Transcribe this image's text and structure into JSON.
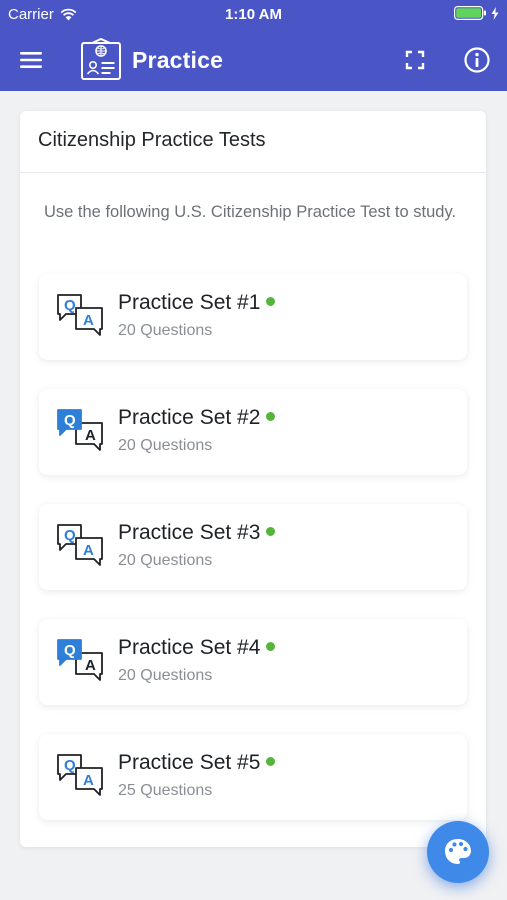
{
  "status_bar": {
    "carrier": "Carrier",
    "time": "1:10 AM"
  },
  "toolbar": {
    "title": "Practice",
    "menu_icon": "hamburger-menu-icon",
    "logo_icon": "citizenship-id-card-icon",
    "expand_icon": "fullscreen-expand-icon",
    "info_icon": "info-icon"
  },
  "card": {
    "title": "Citizenship Practice Tests",
    "description": "Use the following U.S. Citizenship Practice Test to study.",
    "sets": [
      {
        "title": "Practice Set #1",
        "subtitle": "20 Questions",
        "icon": "qa-outline-icon",
        "status_color": "#55b43a"
      },
      {
        "title": "Practice Set #2",
        "subtitle": "20 Questions",
        "icon": "qa-filled-icon",
        "status_color": "#55b43a"
      },
      {
        "title": "Practice Set #3",
        "subtitle": "20 Questions",
        "icon": "qa-outline-icon",
        "status_color": "#55b43a"
      },
      {
        "title": "Practice Set #4",
        "subtitle": "20 Questions",
        "icon": "qa-filled-icon",
        "status_color": "#55b43a"
      },
      {
        "title": "Practice Set #5",
        "subtitle": "25 Questions",
        "icon": "qa-outline-icon",
        "status_color": "#55b43a"
      }
    ]
  },
  "fab": {
    "icon": "palette-icon"
  },
  "colors": {
    "header": "#4a56c6",
    "accent_blue": "#3f8ae8",
    "status_green": "#55b43a"
  }
}
